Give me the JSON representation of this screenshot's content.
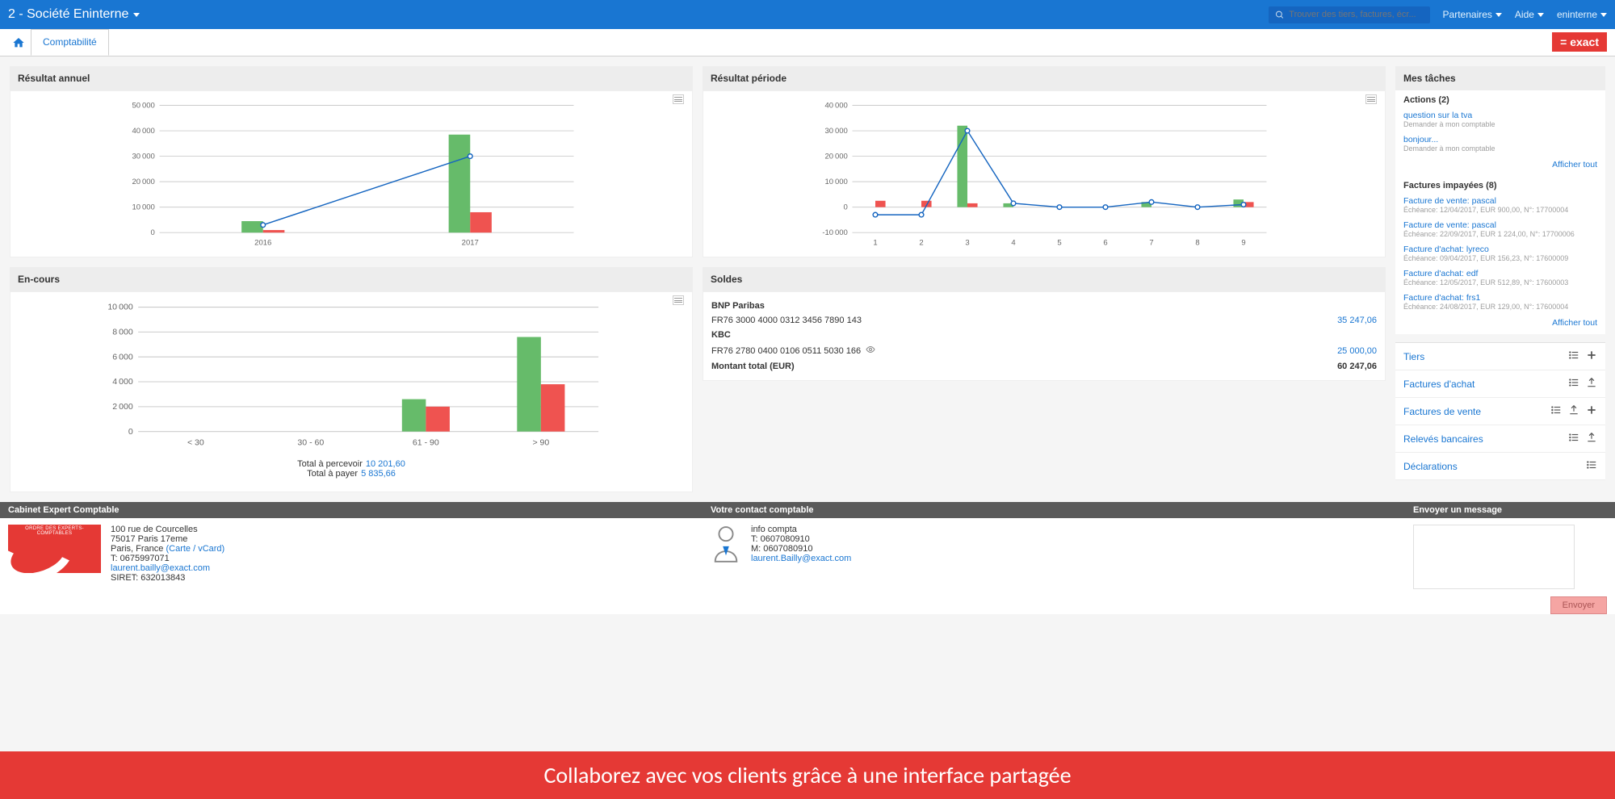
{
  "topbar": {
    "company": "2 - Société Eninterne",
    "search_placeholder": "Trouver des tiers, factures, écr...",
    "partners": "Partenaires",
    "help": "Aide",
    "user": "eninterne"
  },
  "tabs": {
    "main": "Comptabilité"
  },
  "brand": "= exact",
  "cards": {
    "annual": {
      "title": "Résultat annuel"
    },
    "period": {
      "title": "Résultat période"
    },
    "encours": {
      "title": "En-cours",
      "total_receive_label": "Total à percevoir",
      "total_receive": "10 201,60",
      "total_pay_label": "Total à payer",
      "total_pay": "5 835,66"
    },
    "soldes": {
      "title": "Soldes",
      "bank1_name": "BNP Paribas",
      "bank1_iban": "FR76 3000 4000 0312 3456 7890 143",
      "bank1_amt": "35 247,06",
      "bank2_name": "KBC",
      "bank2_iban": "FR76 2780 0400 0106 0511 5030 166",
      "bank2_amt": "25 000,00",
      "total_label": "Montant total (EUR)",
      "total_amt": "60 247,06"
    }
  },
  "chart_data": [
    {
      "id": "annual",
      "type": "bar+line",
      "categories": [
        "2016",
        "2017"
      ],
      "series": [
        {
          "name": "green",
          "values": [
            4500,
            38500
          ]
        },
        {
          "name": "red",
          "values": [
            1000,
            8000
          ]
        }
      ],
      "line": [
        3000,
        30000
      ],
      "ylim": [
        0,
        50000
      ],
      "ytick": 10000
    },
    {
      "id": "period",
      "type": "bar+line",
      "categories": [
        "1",
        "2",
        "3",
        "4",
        "5",
        "6",
        "7",
        "8",
        "9"
      ],
      "series": [
        {
          "name": "green",
          "values": [
            0,
            0,
            32000,
            1500,
            0,
            0,
            2000,
            0,
            3000
          ]
        },
        {
          "name": "red",
          "values": [
            2500,
            2500,
            1500,
            0,
            0,
            0,
            0,
            0,
            2000
          ]
        }
      ],
      "line": [
        -3000,
        -3000,
        30000,
        1500,
        0,
        0,
        2000,
        0,
        1000
      ],
      "ylim": [
        -10000,
        40000
      ],
      "ytick": 10000
    },
    {
      "id": "encours",
      "type": "bar",
      "categories": [
        "< 30",
        "30 - 60",
        "61 - 90",
        "> 90"
      ],
      "series": [
        {
          "name": "green",
          "values": [
            0,
            0,
            2600,
            7600
          ]
        },
        {
          "name": "red",
          "values": [
            0,
            0,
            2000,
            3800
          ]
        }
      ],
      "ylim": [
        0,
        10000
      ],
      "ytick": 2000
    }
  ],
  "sidebar": {
    "mytasks_title": "Mes tâches",
    "actions_title": "Actions (2)",
    "actions": [
      {
        "title": "question sur la tva",
        "meta": "Demander à mon comptable"
      },
      {
        "title": "bonjour...",
        "meta": "Demander à mon comptable"
      }
    ],
    "show_all": "Afficher tout",
    "unpaid_title": "Factures impayées (8)",
    "unpaid": [
      {
        "title": "Facture de vente: pascal",
        "meta": "Échéance: 12/04/2017, EUR 900,00, N°: 17700004"
      },
      {
        "title": "Facture de vente: pascal",
        "meta": "Échéance: 22/09/2017, EUR 1 224,00, N°: 17700006"
      },
      {
        "title": "Facture d'achat: lyreco",
        "meta": "Échéance: 09/04/2017, EUR 156,23, N°: 17600009"
      },
      {
        "title": "Facture d'achat: edf",
        "meta": "Échéance: 12/05/2017, EUR 512,89, N°: 17600003"
      },
      {
        "title": "Facture d'achat: frs1",
        "meta": "Échéance: 24/08/2017, EUR 129,00, N°: 17600004"
      }
    ],
    "quicknav": [
      {
        "label": "Tiers",
        "icons": [
          "list",
          "plus"
        ]
      },
      {
        "label": "Factures d'achat",
        "icons": [
          "list",
          "upload"
        ]
      },
      {
        "label": "Factures de vente",
        "icons": [
          "list",
          "upload",
          "plus"
        ]
      },
      {
        "label": "Relevés bancaires",
        "icons": [
          "list",
          "upload"
        ]
      },
      {
        "label": "Déclarations",
        "icons": [
          "list"
        ]
      }
    ]
  },
  "footer": {
    "col1_title": "Cabinet Expert Comptable",
    "col2_title": "Votre contact comptable",
    "col3_title": "Envoyer un message",
    "addr1": "100 rue de Courcelles",
    "addr2": "75017 Paris 17eme",
    "addr3_pre": "Paris, France ",
    "addr3_link": "(Carte / vCard)",
    "tel": "T: 0675997071",
    "email": "laurent.bailly@exact.com",
    "siret": "SIRET: 632013843",
    "contact_name": "info compta",
    "contact_t": "T: 0607080910",
    "contact_m": "M: 0607080910",
    "contact_email": "laurent.Bailly@exact.com",
    "send": "Envoyer",
    "logo_text": "ORDRE DES EXPERTS-COMPTABLES"
  },
  "banner": "Collaborez avec vos clients grâce à une interface partagée"
}
